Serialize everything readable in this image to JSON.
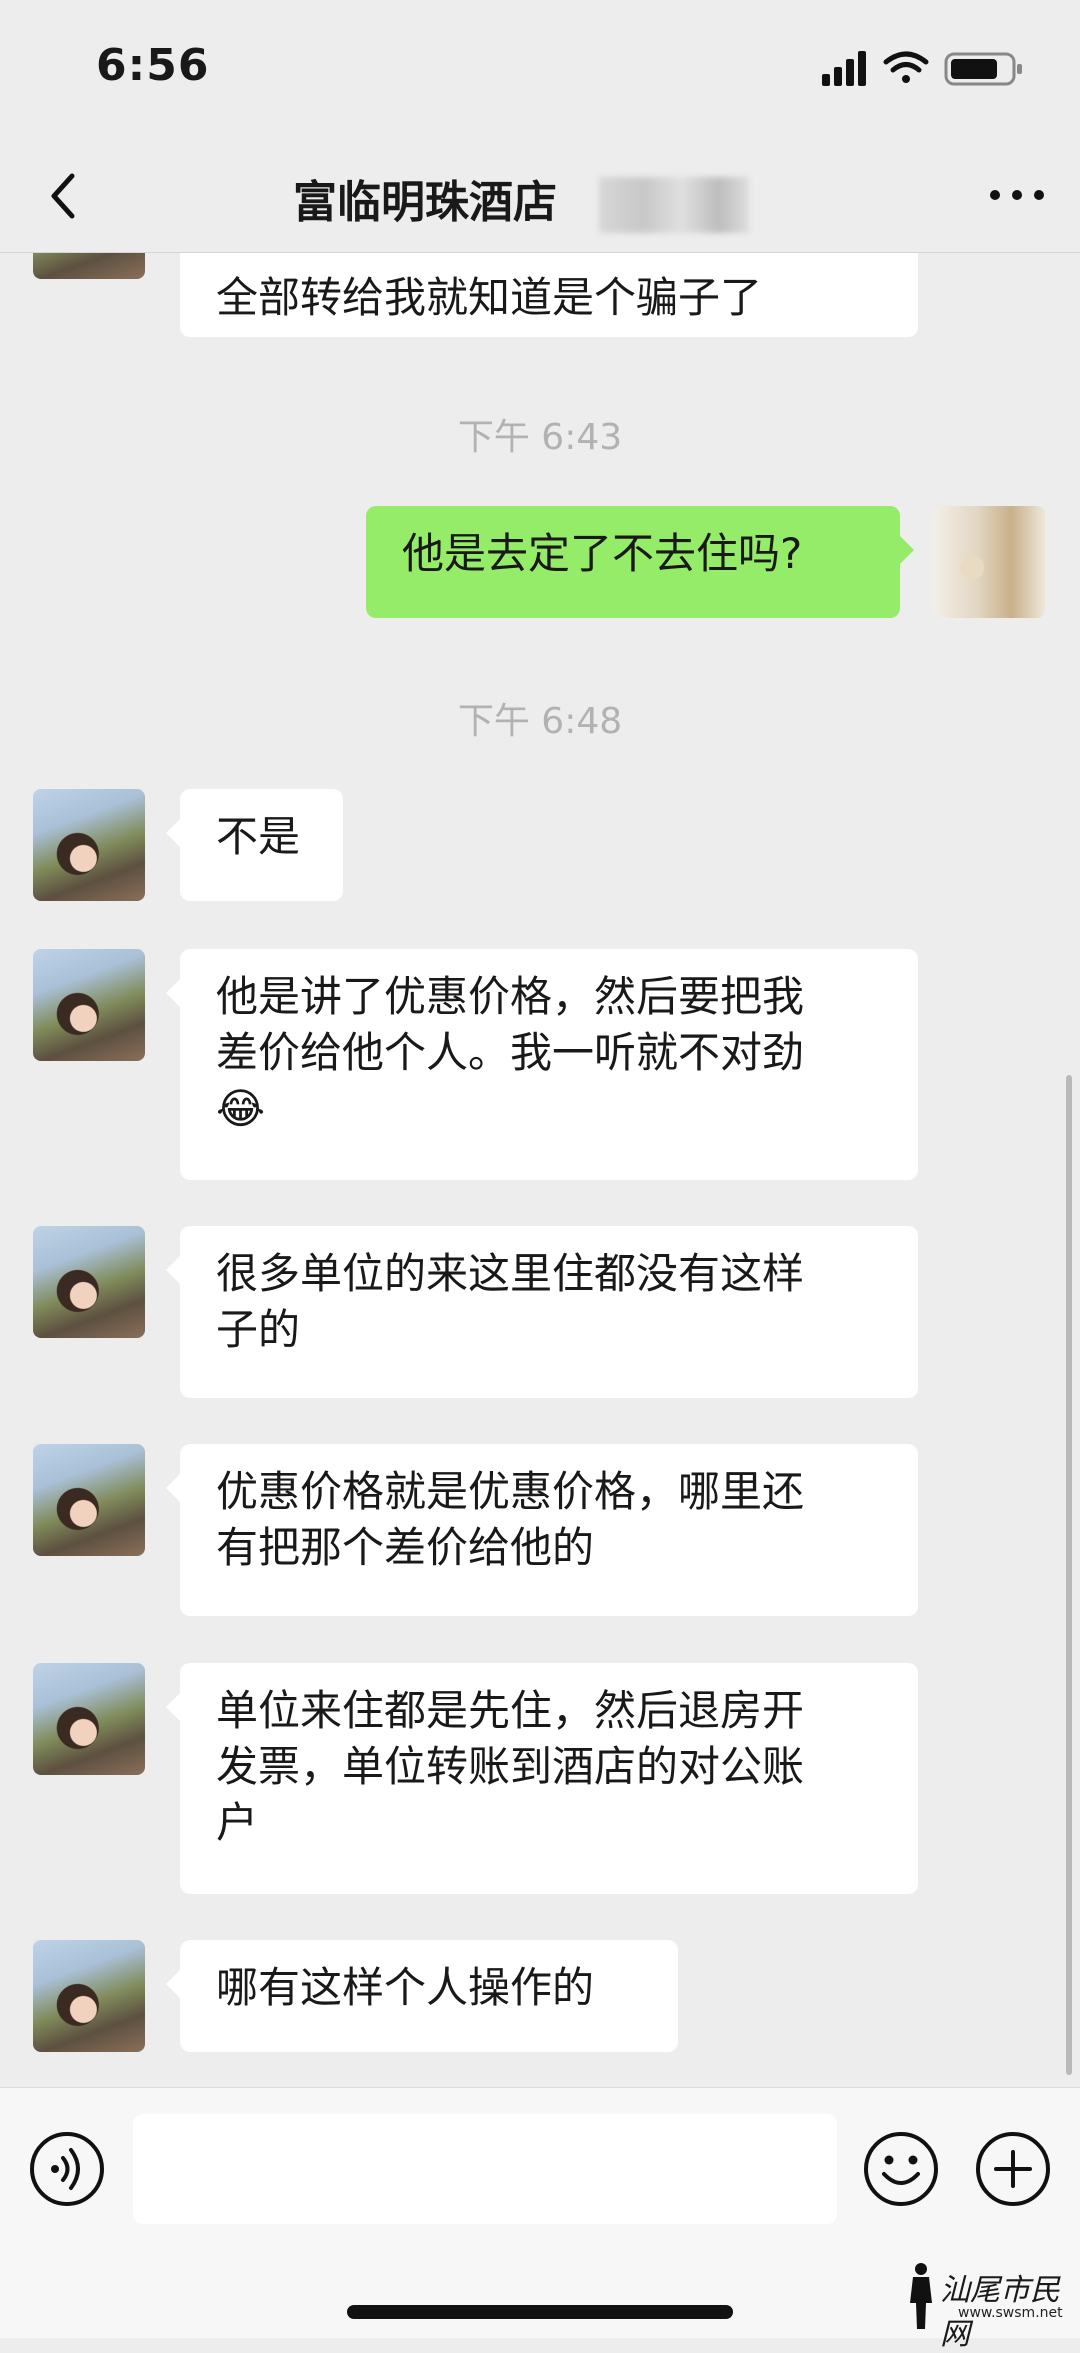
{
  "status_bar": {
    "time": "6:56"
  },
  "nav": {
    "title": "富临明珠酒店"
  },
  "messages": [
    {
      "side": "them",
      "lines": [
        "全部转给我就知道是个骗子了"
      ]
    },
    {
      "type": "timestamp",
      "text": "下午 6:43"
    },
    {
      "side": "me",
      "lines": [
        "他是去定了不去住吗?"
      ]
    },
    {
      "type": "timestamp",
      "text": "下午 6:48"
    },
    {
      "side": "them",
      "lines": [
        "不是"
      ]
    },
    {
      "side": "them",
      "lines": [
        "他是讲了优惠价格，然后要把我",
        "差价给他个人。我一听就不对劲",
        "😂"
      ]
    },
    {
      "side": "them",
      "lines": [
        "很多单位的来这里住都没有这样",
        "子的"
      ]
    },
    {
      "side": "them",
      "lines": [
        "优惠价格就是优惠价格，哪里还",
        "有把那个差价给他的"
      ]
    },
    {
      "side": "them",
      "lines": [
        "单位来住都是先住，然后退房开",
        "发票，单位转账到酒店的对公账",
        "户"
      ]
    },
    {
      "side": "them",
      "lines": [
        "哪有这样个人操作的"
      ]
    }
  ],
  "input": {
    "value": ""
  },
  "icons": {
    "back": "chevron-left-icon",
    "more": "more-dots-icon",
    "voice": "voice-icon",
    "emoji": "emoji-icon",
    "plus": "plus-icon"
  },
  "watermark": {
    "text": "汕尾市民网",
    "url": "www.swsm.net"
  },
  "colors": {
    "background": "#ededed",
    "bubble_me": "#95ec69",
    "bubble_them": "#ffffff",
    "timestamp": "#b2b2b2"
  }
}
